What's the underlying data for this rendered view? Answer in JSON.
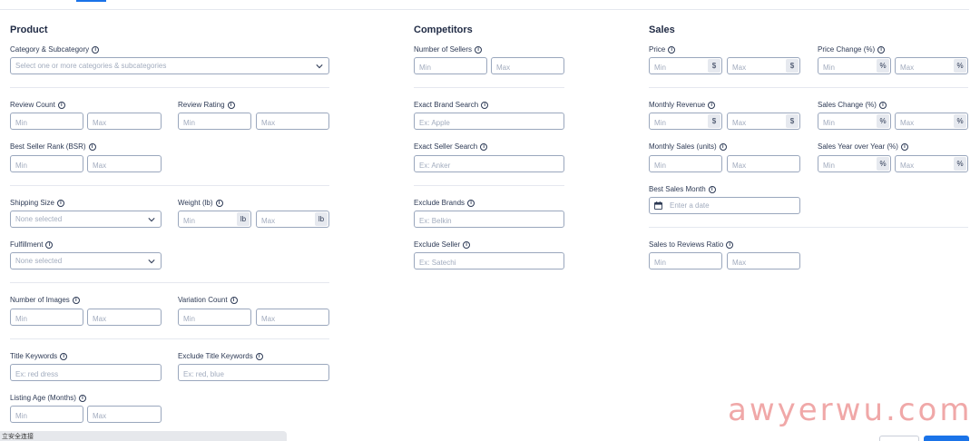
{
  "sections": {
    "product": "Product",
    "competitors": "Competitors",
    "sales": "Sales"
  },
  "product": {
    "category": {
      "label": "Category & Subcategory",
      "placeholder": "Select one or more categories & subcategories"
    },
    "review_count": {
      "label": "Review Count",
      "min": "Min",
      "max": "Max"
    },
    "review_rating": {
      "label": "Review Rating",
      "min": "Min",
      "max": "Max"
    },
    "bsr": {
      "label": "Best Seller Rank (BSR)",
      "min": "Min",
      "max": "Max"
    },
    "shipping_size": {
      "label": "Shipping Size",
      "placeholder": "None selected"
    },
    "weight": {
      "label": "Weight (lb)",
      "min": "Min",
      "max": "Max",
      "unit": "lb"
    },
    "fulfillment": {
      "label": "Fulfillment",
      "placeholder": "None selected"
    },
    "num_images": {
      "label": "Number of Images",
      "min": "Min",
      "max": "Max"
    },
    "variation_count": {
      "label": "Variation Count",
      "min": "Min",
      "max": "Max"
    },
    "title_keywords": {
      "label": "Title Keywords",
      "placeholder": "Ex: red dress"
    },
    "exclude_title_keywords": {
      "label": "Exclude Title Keywords",
      "placeholder": "Ex: red, blue"
    },
    "listing_age": {
      "label": "Listing Age (Months)",
      "min": "Min",
      "max": "Max"
    }
  },
  "competitors": {
    "num_sellers": {
      "label": "Number of Sellers",
      "min": "Min",
      "max": "Max"
    },
    "exact_brand": {
      "label": "Exact Brand Search",
      "placeholder": "Ex: Apple"
    },
    "exact_seller": {
      "label": "Exact Seller Search",
      "placeholder": "Ex: Anker"
    },
    "exclude_brands": {
      "label": "Exclude Brands",
      "placeholder": "Ex: Belkin"
    },
    "exclude_seller": {
      "label": "Exclude Seller",
      "placeholder": "Ex: Satechi"
    }
  },
  "sales": {
    "price": {
      "label": "Price",
      "min": "Min",
      "max": "Max",
      "unit": "$"
    },
    "price_change": {
      "label": "Price Change (%)",
      "min": "Min",
      "max": "Max",
      "unit": "%"
    },
    "monthly_revenue": {
      "label": "Monthly Revenue",
      "min": "Min",
      "max": "Max",
      "unit": "$"
    },
    "sales_change": {
      "label": "Sales Change (%)",
      "min": "Min",
      "max": "Max",
      "unit": "%"
    },
    "monthly_sales": {
      "label": "Monthly Sales (units)",
      "min": "Min",
      "max": "Max"
    },
    "sales_yoy": {
      "label": "Sales Year over Year (%)",
      "min": "Min",
      "max": "Max",
      "unit": "%"
    },
    "best_sales_month": {
      "label": "Best Sales Month",
      "placeholder": "Enter a date"
    },
    "sales_to_reviews": {
      "label": "Sales to Reviews Ratio",
      "min": "Min",
      "max": "Max"
    }
  },
  "footer": {
    "status_text": "立安全连接"
  },
  "watermark": "awyerwu.com",
  "colors": {
    "accent": "#1a73e8",
    "border": "#9aa7bd",
    "text": "#1f2a44",
    "watermark": "#f0a8a8"
  }
}
